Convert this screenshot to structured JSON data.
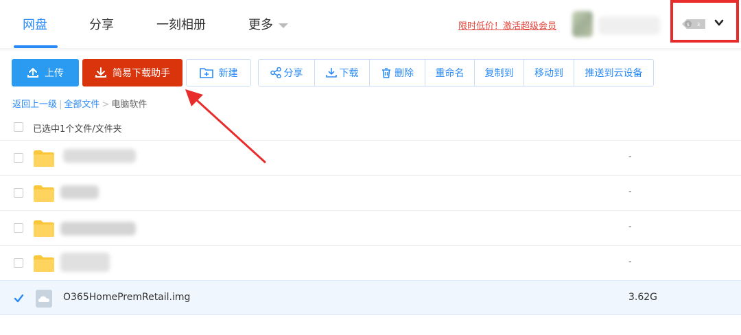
{
  "nav": {
    "tabs": [
      "网盘",
      "分享",
      "一刻相册",
      "更多"
    ],
    "promo": "限时低价！激活超级会员"
  },
  "toolbar": {
    "upload": "上传",
    "helper": "简易下载助手",
    "new": "新建",
    "share": "分享",
    "download": "下载",
    "delete": "删除",
    "rename": "重命名",
    "copy": "复制到",
    "move": "移动到",
    "push": "推送到云设备"
  },
  "breadcrumb": {
    "back": "返回上一级",
    "all": "全部文件",
    "current": "电脑软件"
  },
  "selection": "已选中1个文件/文件夹",
  "files": [
    {
      "name": "",
      "size": "-",
      "type": "folder"
    },
    {
      "name": "",
      "size": "-",
      "type": "folder"
    },
    {
      "name": "",
      "size": "-",
      "type": "folder"
    },
    {
      "name": "",
      "size": "-",
      "type": "folder"
    },
    {
      "name": "O365HomePremRetail.img",
      "size": "3.62G",
      "type": "file"
    }
  ],
  "colors": {
    "accent": "#2a8af6",
    "helper": "#d9340b",
    "annotation": "#e82b2b"
  }
}
